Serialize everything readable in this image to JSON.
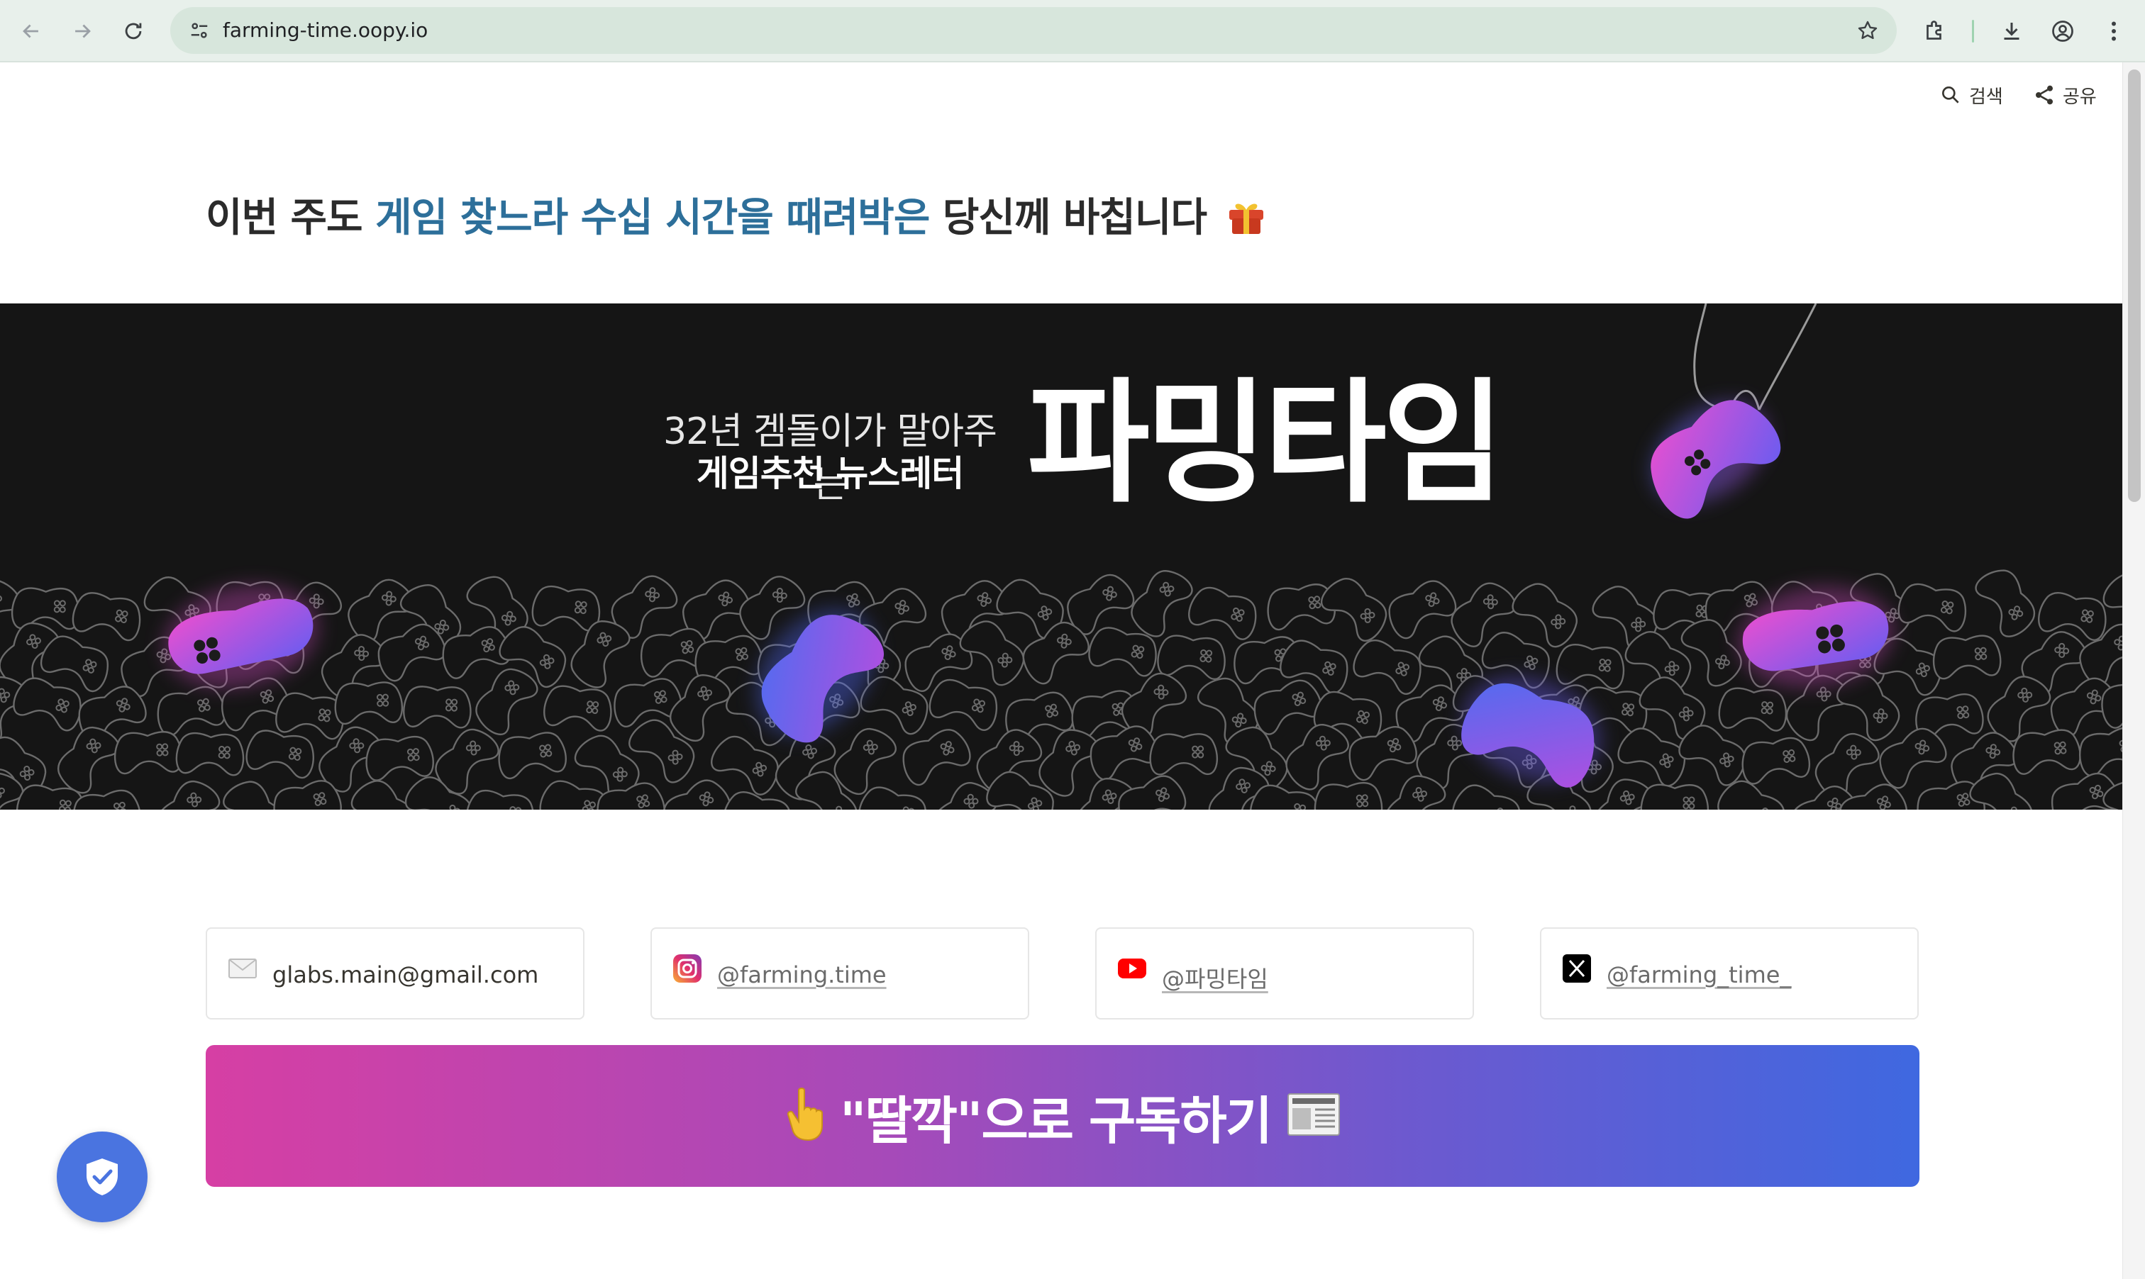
{
  "browser": {
    "url": "farming-time.oopy.io"
  },
  "page_actions": {
    "search_label": "검색",
    "share_label": "공유"
  },
  "heading": {
    "part1": "이번 주도 ",
    "highlight": "게임 찾느라 수십 시간을 때려박은",
    "part2": " 당신께 바칩니다"
  },
  "banner": {
    "subtitle_line1": "32년 겜돌이가 말아주는",
    "subtitle_line2": "게임추천 뉴스레터",
    "title": "파밍타임"
  },
  "contacts": [
    {
      "icon": "mail-icon",
      "text": "glabs.main@gmail.com"
    },
    {
      "icon": "instagram-icon",
      "text": "@farming.time"
    },
    {
      "icon": "youtube-icon",
      "text": "@파밍타임"
    },
    {
      "icon": "x-icon",
      "text": "@farming_time_"
    }
  ],
  "subscribe": {
    "label": "\"딸깍\"으로 구독하기"
  },
  "colors": {
    "heading_highlight": "#2d6f9a",
    "gradient_start": "#d63fa4",
    "gradient_end": "#3f68e0",
    "shield": "#4a74e0"
  }
}
